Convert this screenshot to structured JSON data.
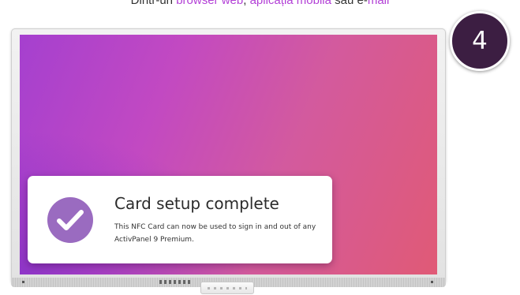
{
  "caption": {
    "prefix": "Dintr-un ",
    "link1": "browser web",
    "separator": ", ",
    "link2": "aplicația mobilă",
    "middle": " sau e-",
    "link3": "mail"
  },
  "step": {
    "number": "4"
  },
  "notification": {
    "title": "Card setup complete",
    "message": "This NFC Card can now be used to sign in and out of any ActivPanel 9 Premium.",
    "icon": "checkmark-icon"
  },
  "colors": {
    "link": "#b23fd6",
    "badge": "#3c1e42",
    "check_circle": "#9a6bc0",
    "screen_start": "#a540cf",
    "screen_end": "#e05a76"
  }
}
